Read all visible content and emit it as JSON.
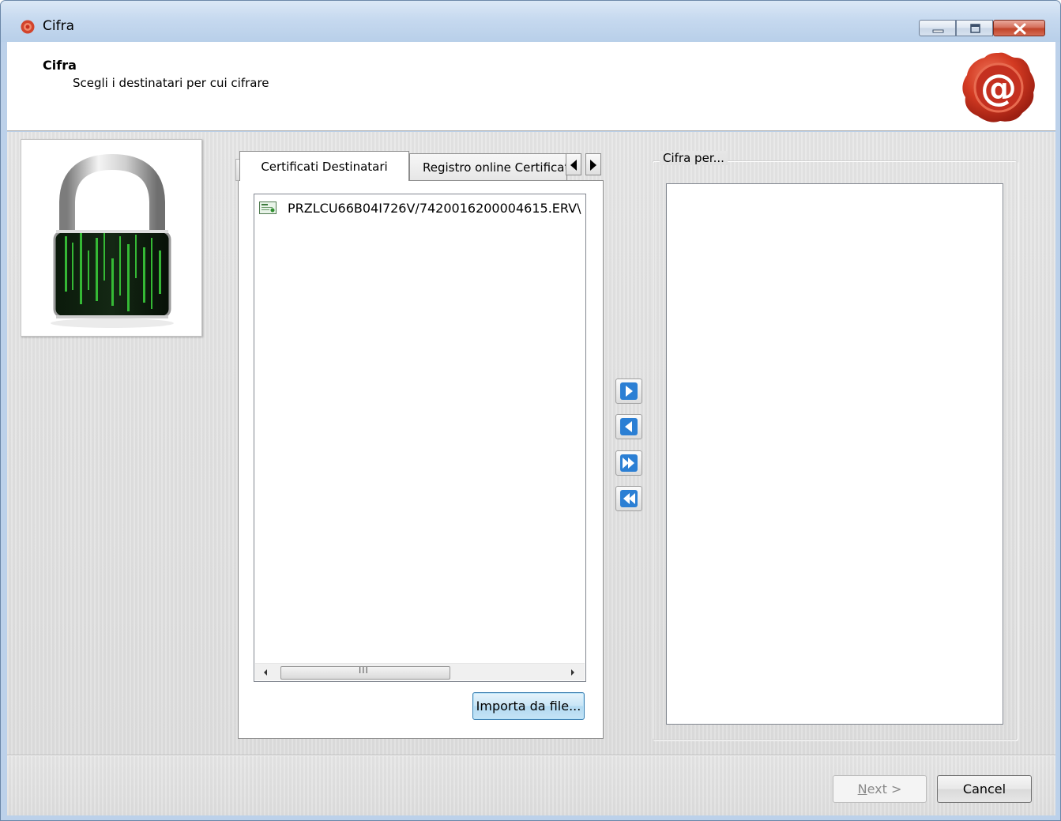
{
  "window": {
    "title": "Cifra",
    "icon": "seal-icon"
  },
  "header": {
    "title": "Cifra",
    "subtitle": "Scegli i destinatari per cui cifrare",
    "logo": "wax-seal-at-icon"
  },
  "tabs": [
    {
      "label": "Certificati Destinatari",
      "active": true
    },
    {
      "label": "Registro online Certificati",
      "active": false
    }
  ],
  "certificates": [
    {
      "label": "PRZLCU66B04I726V/7420016200004615.ERV\\",
      "icon": "certificate-icon"
    }
  ],
  "scrollbar": {
    "grip": "III"
  },
  "import_button": "Importa da file...",
  "transfer": {
    "add": "arrow-right-icon",
    "remove": "arrow-left-icon",
    "add_all": "double-arrow-right-icon",
    "remove_all": "double-arrow-left-icon"
  },
  "target_group": {
    "title": "Cifra per..."
  },
  "footer": {
    "next_mnemonic": "N",
    "next_rest": "ext >",
    "cancel": "Cancel"
  },
  "colors": {
    "accent_blue": "#2b7fd4",
    "seal_red": "#c8301f",
    "titlebar": "#c6d9ef"
  }
}
